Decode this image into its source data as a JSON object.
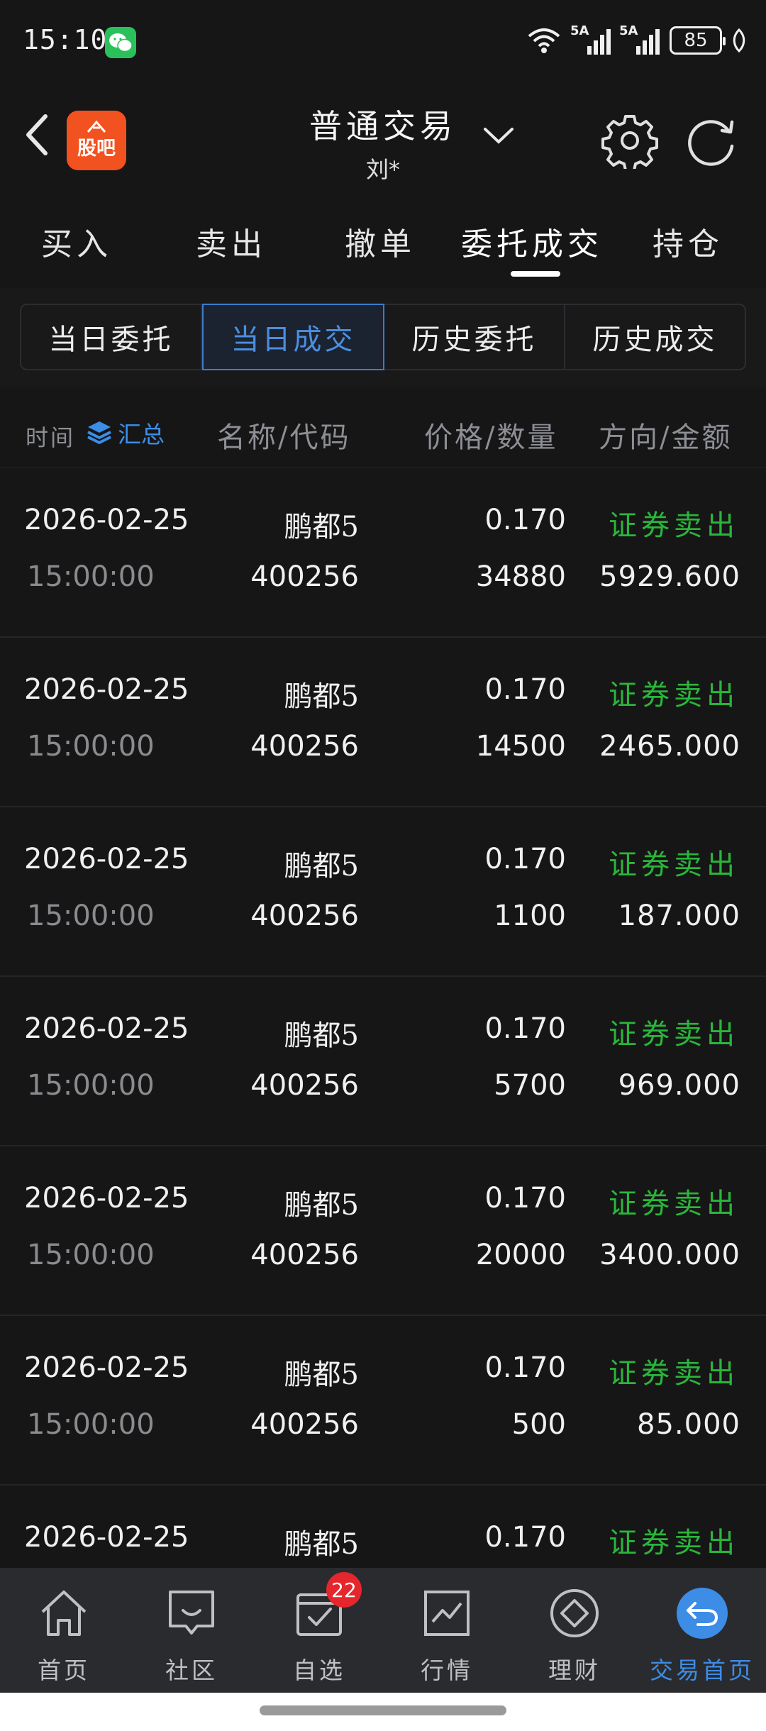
{
  "status_bar": {
    "time": "15:10",
    "network_1": "5A",
    "network_2": "5A",
    "battery": "85"
  },
  "header": {
    "logo_text": "股吧",
    "title": "普通交易",
    "subtitle": "刘*"
  },
  "main_tabs": [
    {
      "label": "买入"
    },
    {
      "label": "卖出"
    },
    {
      "label": "撤单"
    },
    {
      "label": "委托成交"
    },
    {
      "label": "持仓"
    }
  ],
  "sub_tabs": [
    {
      "label": "当日委托"
    },
    {
      "label": "当日成交"
    },
    {
      "label": "历史委托"
    },
    {
      "label": "历史成交"
    }
  ],
  "columns": {
    "time": "时间",
    "summary": "汇总",
    "name_code": "名称/代码",
    "price_qty": "价格/数量",
    "dir_amount": "方向/金额"
  },
  "colors": {
    "accent_blue": "#3d8ce6",
    "sell_green": "#2ab63a",
    "badge_red": "#e5262c",
    "logo_orange": "#f2521f"
  },
  "trades": [
    {
      "date": "2026-02-25",
      "time": "15:00:00",
      "name": "鹏都5",
      "code": "400256",
      "price": "0.170",
      "qty": "34880",
      "direction": "证券卖出",
      "amount": "5929.600"
    },
    {
      "date": "2026-02-25",
      "time": "15:00:00",
      "name": "鹏都5",
      "code": "400256",
      "price": "0.170",
      "qty": "14500",
      "direction": "证券卖出",
      "amount": "2465.000"
    },
    {
      "date": "2026-02-25",
      "time": "15:00:00",
      "name": "鹏都5",
      "code": "400256",
      "price": "0.170",
      "qty": "1100",
      "direction": "证券卖出",
      "amount": "187.000"
    },
    {
      "date": "2026-02-25",
      "time": "15:00:00",
      "name": "鹏都5",
      "code": "400256",
      "price": "0.170",
      "qty": "5700",
      "direction": "证券卖出",
      "amount": "969.000"
    },
    {
      "date": "2026-02-25",
      "time": "15:00:00",
      "name": "鹏都5",
      "code": "400256",
      "price": "0.170",
      "qty": "20000",
      "direction": "证券卖出",
      "amount": "3400.000"
    },
    {
      "date": "2026-02-25",
      "time": "15:00:00",
      "name": "鹏都5",
      "code": "400256",
      "price": "0.170",
      "qty": "500",
      "direction": "证券卖出",
      "amount": "85.000"
    },
    {
      "date": "2026-02-25",
      "time": "",
      "name": "鹏都5",
      "code": "",
      "price": "0.170",
      "qty": "",
      "direction": "证券卖出",
      "amount": ""
    }
  ],
  "bottom_nav": [
    {
      "label": "首页",
      "icon": "home-icon"
    },
    {
      "label": "社区",
      "icon": "community-icon"
    },
    {
      "label": "自选",
      "icon": "watchlist-icon",
      "badge": "22"
    },
    {
      "label": "行情",
      "icon": "market-chart-icon"
    },
    {
      "label": "理财",
      "icon": "finance-diamond-icon"
    },
    {
      "label": "交易首页",
      "icon": "trade-home-return-icon"
    }
  ]
}
